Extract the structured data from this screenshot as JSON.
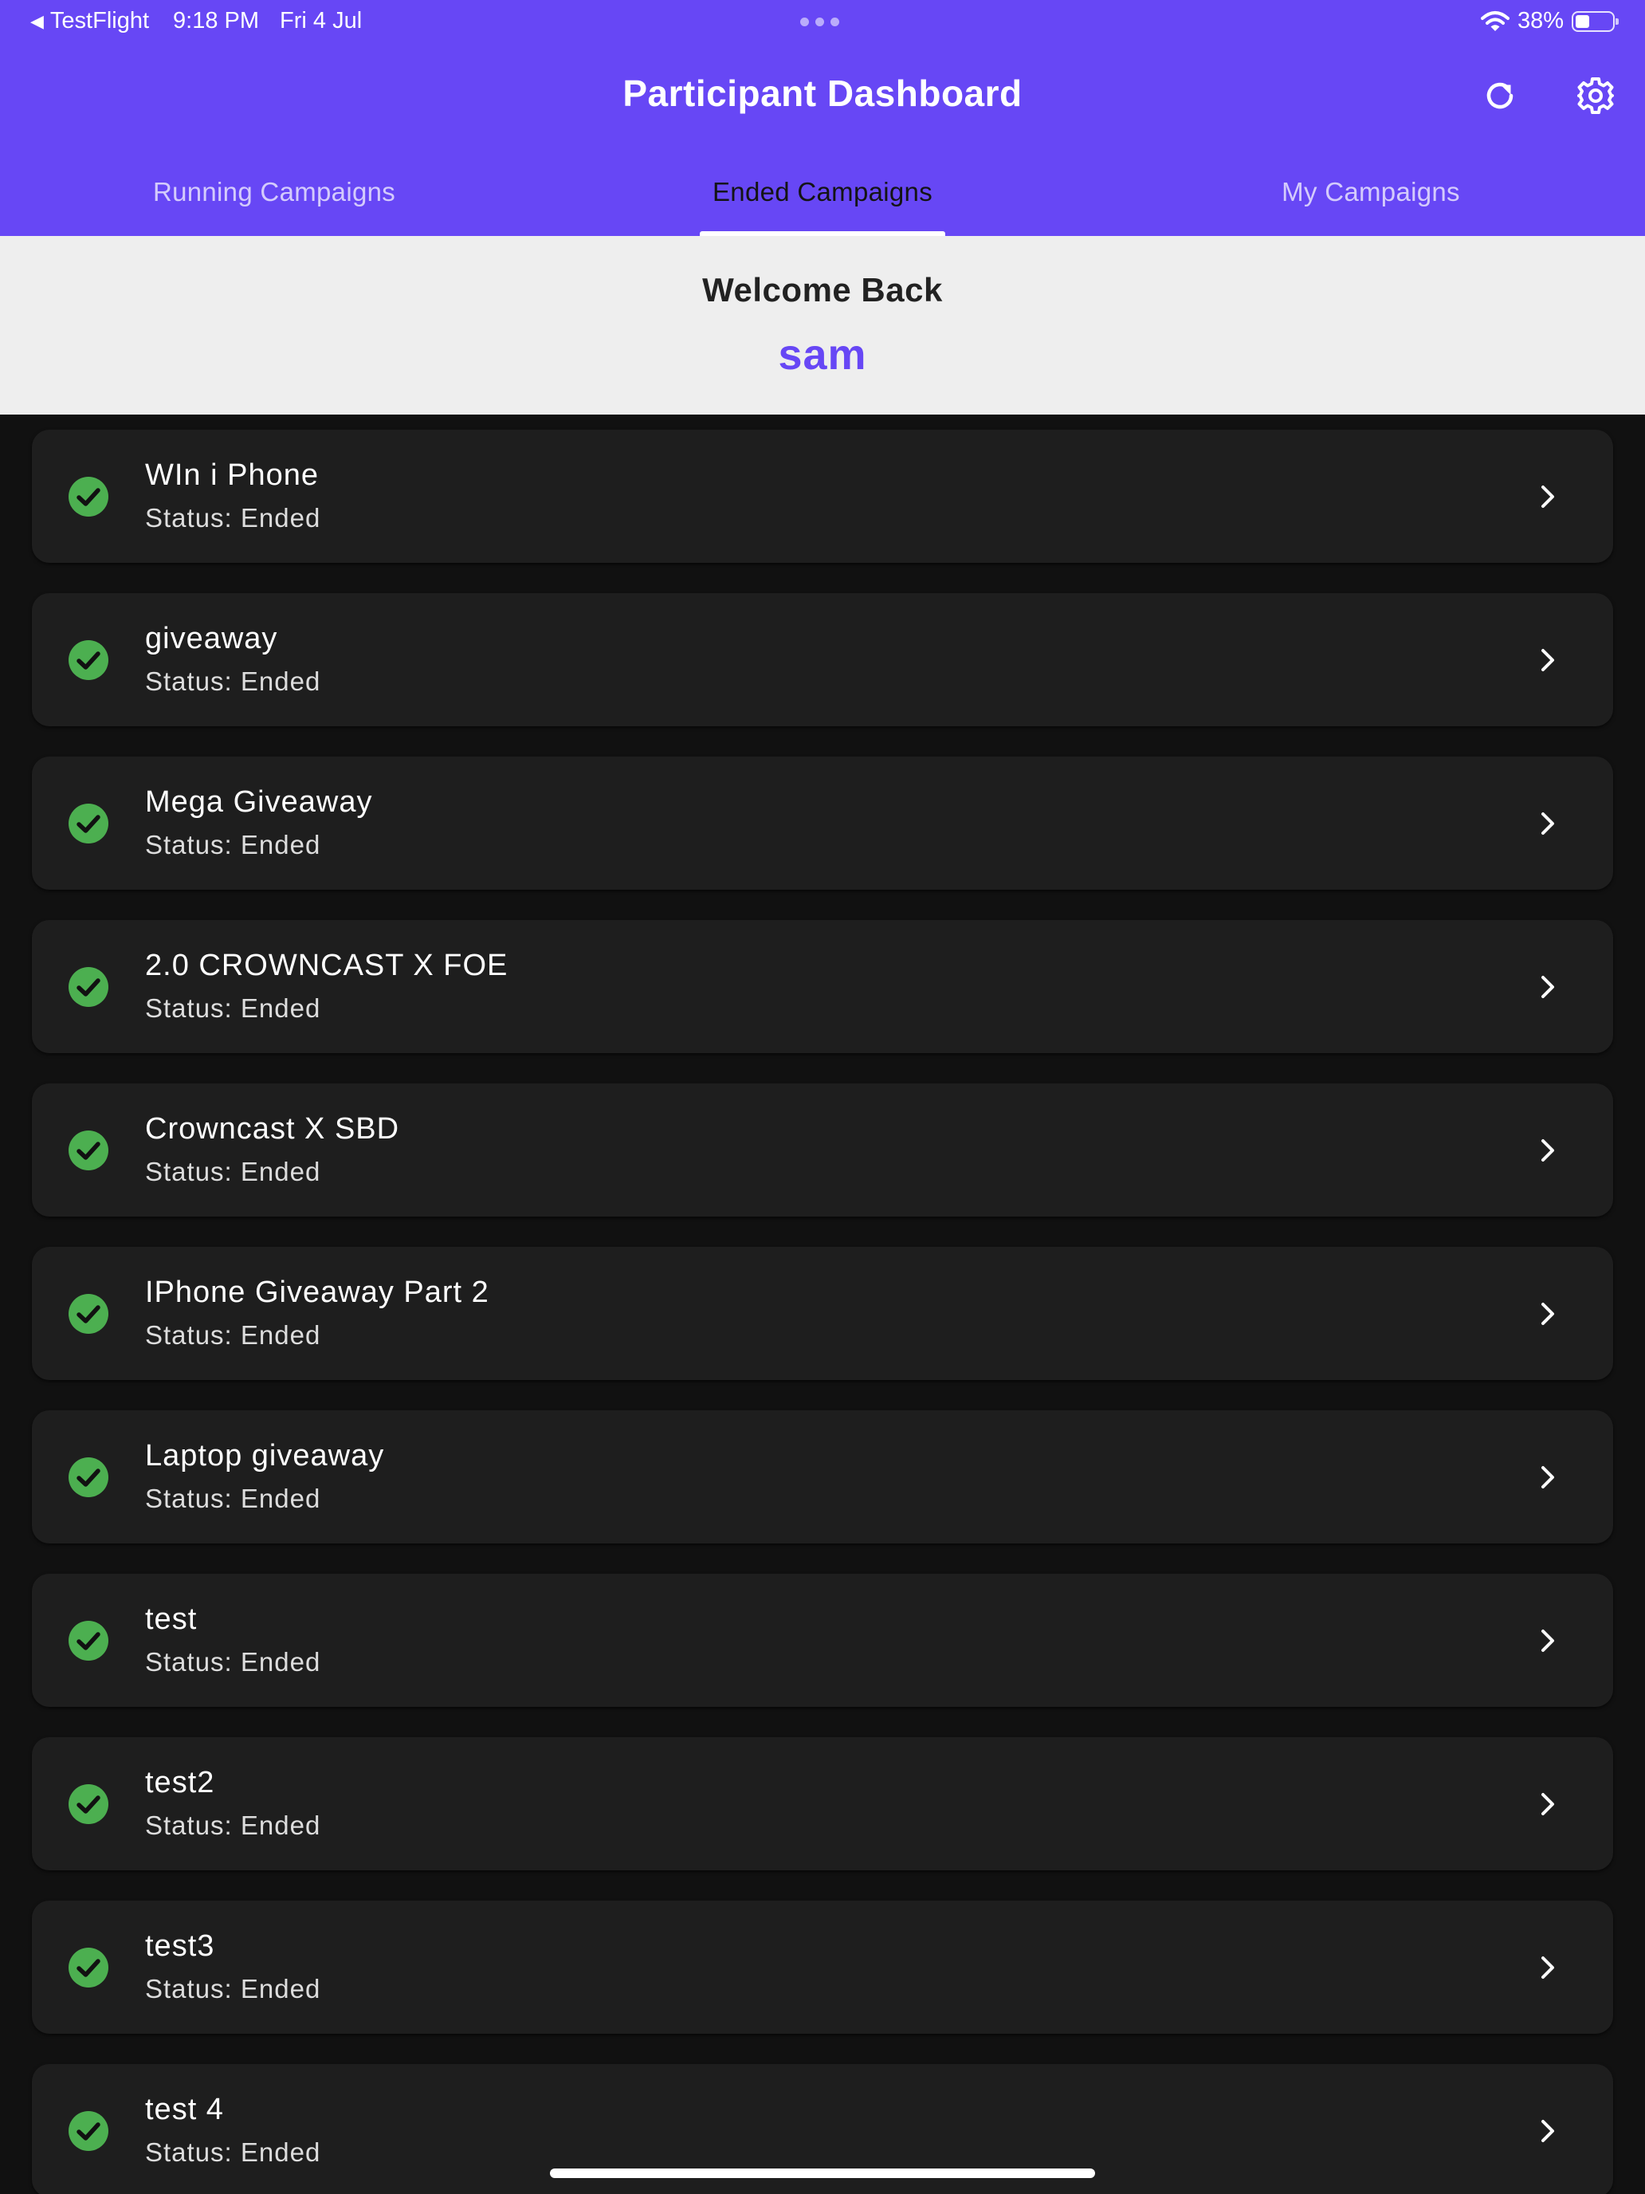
{
  "status_bar": {
    "back_glyph": "◀",
    "app_name": "TestFlight",
    "time": "9:18 PM",
    "date": "Fri 4 Jul",
    "battery_percent": "38%",
    "battery_level": 0.38,
    "wifi_icon": "wifi-icon"
  },
  "header": {
    "title": "Participant Dashboard",
    "refresh_icon": "refresh-icon",
    "settings_icon": "gear-icon"
  },
  "tabs": [
    {
      "label": "Running Campaigns",
      "active": false
    },
    {
      "label": "Ended Campaigns",
      "active": true
    },
    {
      "label": "My Campaigns",
      "active": false
    }
  ],
  "welcome": {
    "label": "Welcome Back",
    "name": "sam"
  },
  "campaigns": [
    {
      "title": "WIn i Phone",
      "status": "Status: Ended"
    },
    {
      "title": "giveaway",
      "status": "Status: Ended"
    },
    {
      "title": "Mega Giveaway",
      "status": "Status: Ended"
    },
    {
      "title": "2.0 CROWNCAST X FOE",
      "status": "Status: Ended"
    },
    {
      "title": "Crowncast X SBD",
      "status": "Status: Ended"
    },
    {
      "title": "IPhone Giveaway Part 2",
      "status": "Status: Ended"
    },
    {
      "title": "Laptop giveaway",
      "status": "Status: Ended"
    },
    {
      "title": "test",
      "status": "Status: Ended"
    },
    {
      "title": "test2",
      "status": "Status: Ended"
    },
    {
      "title": "test3",
      "status": "Status: Ended"
    },
    {
      "title": "test 4",
      "status": "Status: Ended"
    }
  ],
  "colors": {
    "primary": "#6747f5",
    "check_green": "#4caf50",
    "card_bg": "#1e1e1e",
    "page_bg": "#111111",
    "welcome_bg": "#eeeeee"
  }
}
